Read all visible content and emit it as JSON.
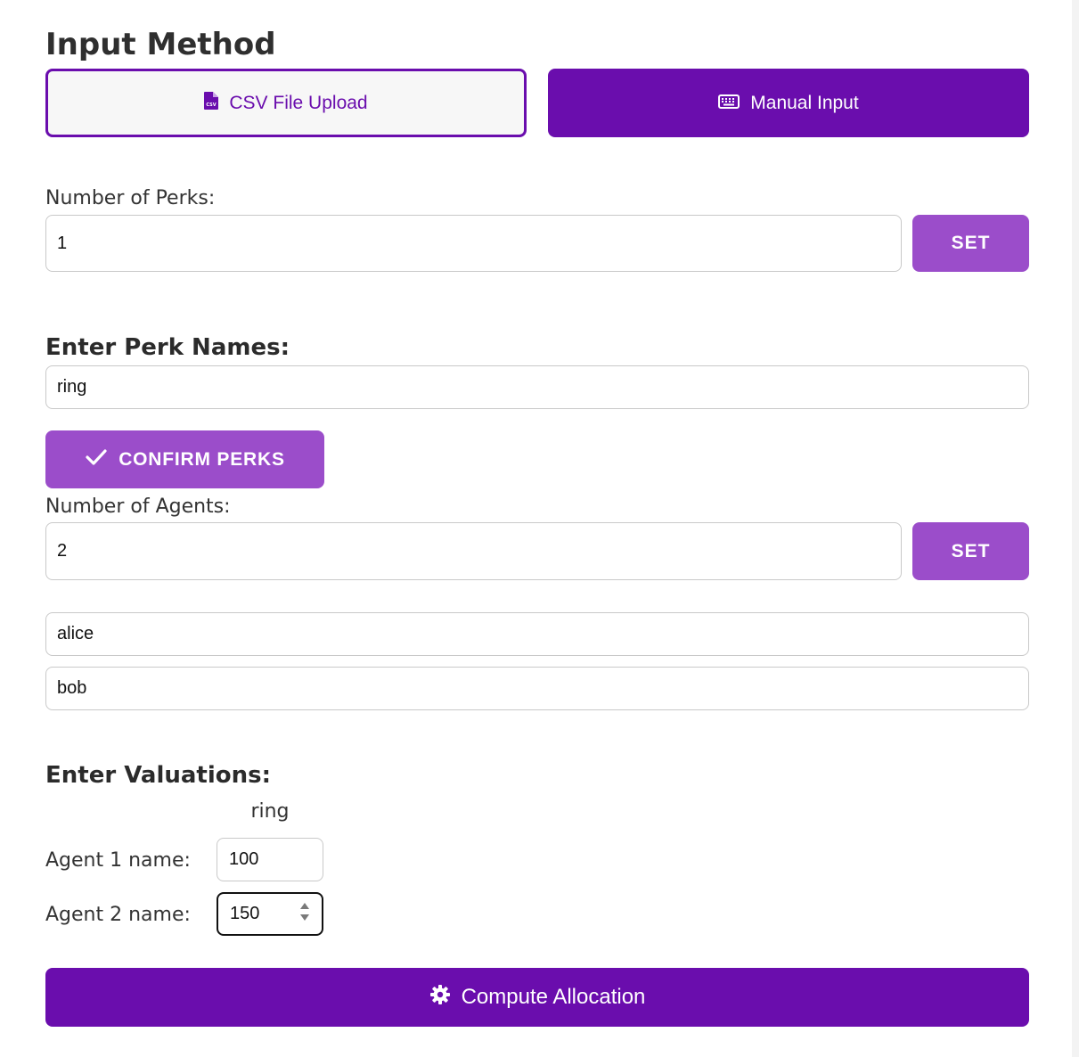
{
  "header": {
    "title": "Input Method"
  },
  "input_method": {
    "csv_label": "CSV File Upload",
    "csv_icon": "csv-file-icon",
    "manual_label": "Manual Input",
    "manual_icon": "keyboard-icon",
    "selected": "Manual Input"
  },
  "perks": {
    "count_label": "Number of Perks:",
    "count_value": "1",
    "set_label": "SET",
    "names_heading": "Enter Perk Names:",
    "names": [
      "ring"
    ],
    "confirm_label": "CONFIRM PERKS"
  },
  "agents": {
    "count_label": "Number of Agents:",
    "count_value": "2",
    "set_label": "SET",
    "names": [
      "alice",
      "bob"
    ]
  },
  "valuations": {
    "heading": "Enter Valuations:",
    "columns": [
      "ring"
    ],
    "rows": [
      {
        "label": "Agent 1 name:",
        "values": [
          "100"
        ]
      },
      {
        "label": "Agent 2 name:",
        "values": [
          "150"
        ]
      }
    ]
  },
  "actions": {
    "compute_label": "Compute Allocation",
    "compute_icon": "gear-icon"
  },
  "colors": {
    "primary": "#6a0dad",
    "secondary": "#9b4dca"
  }
}
